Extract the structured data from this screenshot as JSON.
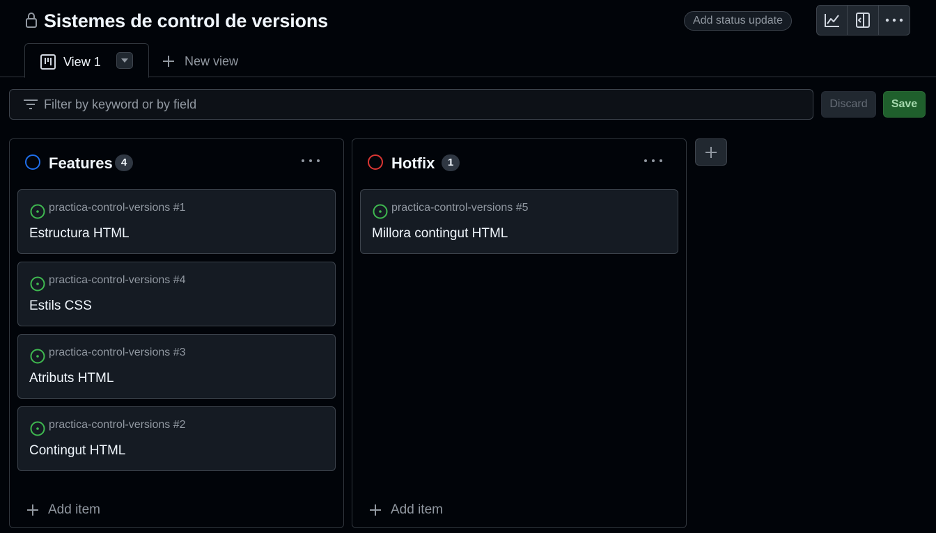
{
  "header": {
    "title": "Sistemes de control de versions",
    "status_button": "Add status update",
    "icons": [
      "lock-icon",
      "insights-graph-icon",
      "side-panel-icon",
      "kebab-menu-icon"
    ]
  },
  "tabs": {
    "active_label": "View 1",
    "new_view_label": "New view"
  },
  "filter": {
    "placeholder": "Filter by keyword or by field",
    "value": "",
    "discard_label": "Discard",
    "save_label": "Save"
  },
  "colors": {
    "features_status": "#1f6feb",
    "hotfix_status": "#da3633",
    "open_issue": "#3fb950",
    "save_green": "#238636"
  },
  "columns": [
    {
      "name": "Features",
      "count": "4",
      "cards": [
        {
          "ref": "practica-control-versions #1",
          "title": "Estructura HTML"
        },
        {
          "ref": "practica-control-versions #4",
          "title": "Estils CSS"
        },
        {
          "ref": "practica-control-versions #3",
          "title": "Atributs HTML"
        },
        {
          "ref": "practica-control-versions #2",
          "title": "Contingut HTML"
        }
      ],
      "add_item_label": "Add item"
    },
    {
      "name": "Hotfix",
      "count": "1",
      "cards": [
        {
          "ref": "practica-control-versions #5",
          "title": "Millora contingut HTML"
        }
      ],
      "add_item_label": "Add item"
    }
  ]
}
